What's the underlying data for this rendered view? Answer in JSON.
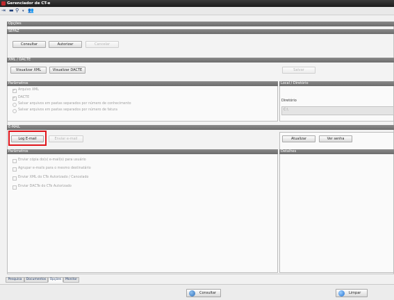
{
  "window": {
    "title": "Gerenciador de CT-e"
  },
  "toolbar": {
    "icons": [
      "exit-icon",
      "monitor-icon",
      "search-icon",
      "users-icon"
    ]
  },
  "opcoes": {
    "label": "Opções"
  },
  "sefaz": {
    "header": "SEFAZ",
    "consultar": "Consultar",
    "autorizar": "Autorizar",
    "cancelar": "Cancelar"
  },
  "xml": {
    "header": "XML / DACTE",
    "visualizar_xml": "Visualizar XML",
    "visualizar_dacte": "Visualizar DACTE",
    "salvar": "Salvar",
    "parametros_header": "Parâmetros",
    "options": [
      "Arquivo XML",
      "DACTE",
      "Salvar arquivos em pastas separados por número de conhecimento",
      "Salvar arquivos em pastas separados por número de fatura"
    ],
    "local_header": "Local / Diretório",
    "diretorio_label": "Diretório",
    "diretorio_value": "C:\\"
  },
  "email": {
    "header": "E-MAIL",
    "log_email": "Log E-mail",
    "enviar_email": "Enviar e-mail",
    "atualizar": "Atualizar",
    "ver_senha": "Ver senha",
    "parametros_header": "Parâmetros",
    "detalhes_header": "Detalhes",
    "options": [
      "Enviar cópia do(s) e-mail(s) para usuário",
      "Agrupar e-mails para o mesmo destinatário",
      "Enviar XML do CTe Autorizado / Cancelado",
      "Enviar DACTe do CTe Autorizado"
    ]
  },
  "tabs": [
    "Pesquisa",
    "Documentos",
    "Opções",
    "Monitor"
  ],
  "footer": {
    "consultar": "Consultar",
    "limpar": "Limpar"
  },
  "colors": {
    "highlight": "#e0151b",
    "header_gray": "#7a7a7a",
    "footer_icon": "#3a7fd0"
  }
}
